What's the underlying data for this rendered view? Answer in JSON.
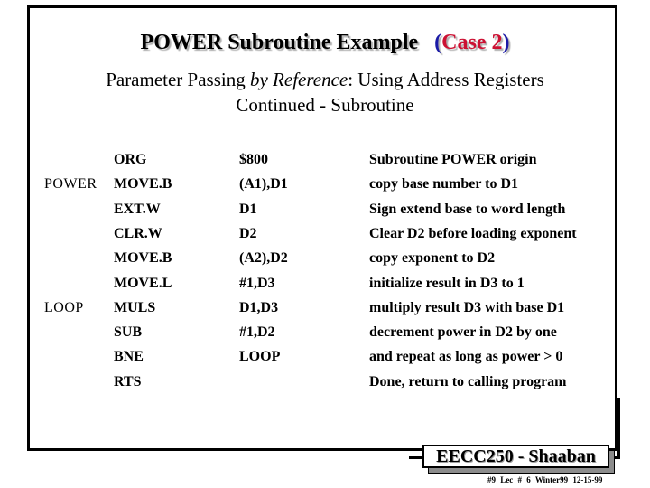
{
  "slide": {
    "title": {
      "main": "POWER Subroutine Example",
      "open_paren": "(",
      "case_label": "Case 2",
      "close_paren": ")"
    },
    "subtitle": {
      "line1_prefix": "Parameter Passing ",
      "line1_italic": "by Reference",
      "line1_suffix": ": Using Address Registers",
      "line2": "Continued -  Subroutine"
    },
    "code": [
      {
        "label": "",
        "op": "ORG",
        "operand": "$800",
        "comment": "Subroutine  POWER origin"
      },
      {
        "label": "POWER",
        "op": "MOVE.B",
        "operand": "(A1),D1",
        "comment": "copy base number to D1"
      },
      {
        "label": "",
        "op": "EXT.W",
        "operand": "D1",
        "comment": "Sign extend base to word length"
      },
      {
        "label": "",
        "op": "CLR.W",
        "operand": "D2",
        "comment": "Clear D2 before loading exponent"
      },
      {
        "label": "",
        "op": "MOVE.B",
        "operand": "(A2),D2",
        "comment": "copy exponent to D2"
      },
      {
        "label": "",
        "op": "MOVE.L",
        "operand": "#1,D3",
        "comment": "initialize result in D3 to 1"
      },
      {
        "label": "LOOP",
        "op": "MULS",
        "operand": "D1,D3",
        "comment": "multiply result D3 with base D1"
      },
      {
        "label": "",
        "op": "SUB",
        "operand": "#1,D2",
        "comment": "decrement power in D2 by one"
      },
      {
        "label": "",
        "op": "BNE",
        "operand": "LOOP",
        "comment": "and repeat as long as power > 0"
      },
      {
        "label": "",
        "op": "RTS",
        "operand": "",
        "comment": "Done, return to calling program"
      }
    ],
    "footer": {
      "course": "EECC250 - Shaaban",
      "meta": "#9   Lec # 6  Winter99  12-15-99"
    },
    "colors": {
      "paren": "#1a1aa6",
      "case": "#cc1133"
    }
  }
}
